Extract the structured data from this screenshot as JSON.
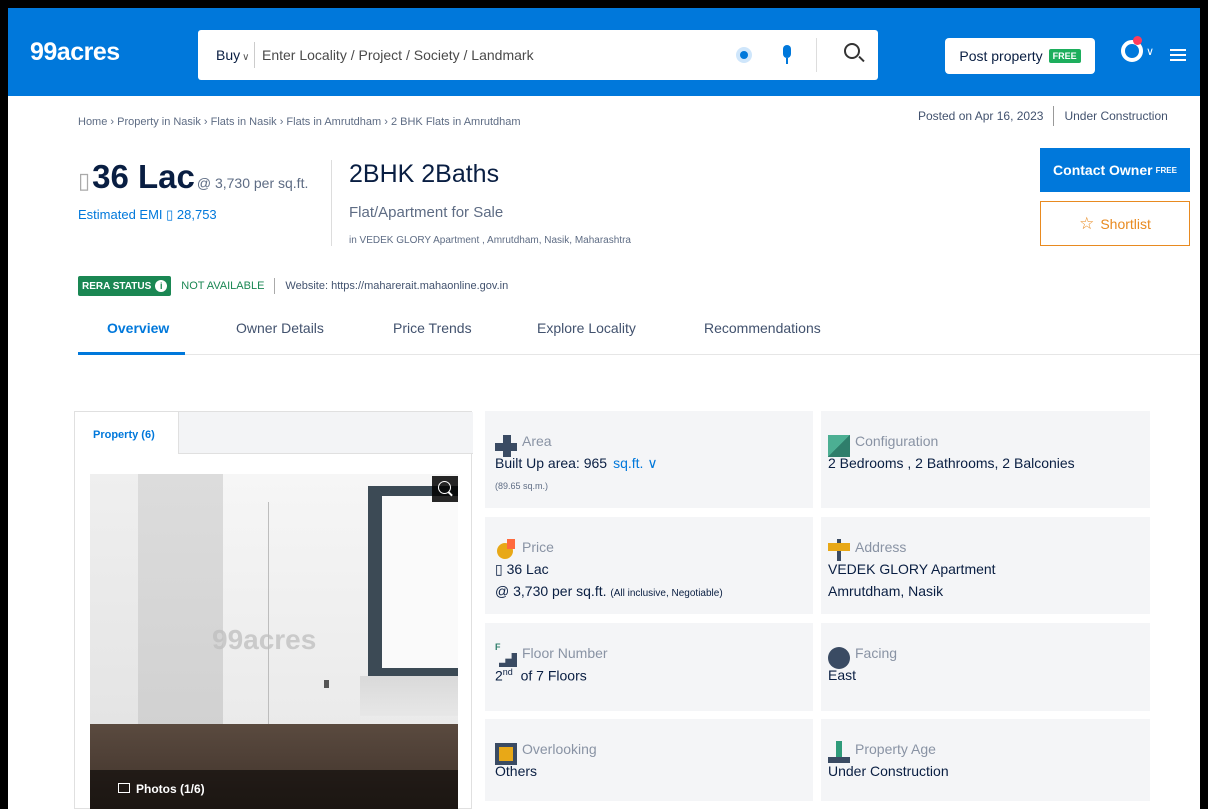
{
  "header": {
    "logo": "99acres",
    "buy_label": "Buy",
    "search_placeholder": "Enter Locality / Project / Society / Landmark",
    "post_property_label": "Post property",
    "free_tag": "FREE"
  },
  "breadcrumb": "Home › Property in Nasik › Flats in Nasik › Flats in Amrutdham › 2 BHK Flats in Amrutdham",
  "posted": {
    "date": "Posted on Apr 16, 2023",
    "status": "Under Construction"
  },
  "listing": {
    "currency_glyph": "▯",
    "price": "36 Lac",
    "price_per_sqft": "@ 3,730 per sq.ft.",
    "emi": "Estimated EMI ▯ 28,753",
    "title": "2BHK 2Baths",
    "type": "Flat/Apartment for Sale",
    "location": "in VEDEK GLORY Apartment , Amrutdham, Nasik, Maharashtra"
  },
  "actions": {
    "contact_owner": "Contact Owner",
    "contact_free": "FREE",
    "shortlist": "Shortlist"
  },
  "rera": {
    "badge": "RERA STATUS",
    "info": "i",
    "status": "NOT AVAILABLE",
    "website": "Website: https://maharerait.mahaonline.gov.in"
  },
  "tabs": [
    {
      "label": "Overview",
      "active": true
    },
    {
      "label": "Owner Details"
    },
    {
      "label": "Price Trends"
    },
    {
      "label": "Explore Locality"
    },
    {
      "label": "Recommendations"
    }
  ],
  "gallery": {
    "tab_label": "Property (6)",
    "watermark": "99acres",
    "photos_label": "Photos (1/6)"
  },
  "details": {
    "area": {
      "label": "Area",
      "value": "Built Up area: 965",
      "unit": "sq.ft.",
      "sub": "(89.65 sq.m.)"
    },
    "configuration": {
      "label": "Configuration",
      "value": "2 Bedrooms , 2 Bathrooms, 2 Balconies"
    },
    "price": {
      "label": "Price",
      "value": "▯ 36 Lac",
      "psf": "@ 3,730 per sq.ft.",
      "note": "(All inclusive, Negotiable)"
    },
    "address": {
      "label": "Address",
      "line1": "VEDEK GLORY Apartment",
      "line2": "Amrutdham, Nasik"
    },
    "floor": {
      "label": "Floor Number",
      "floor": "2",
      "suffix": "nd",
      "rest": "of 7 Floors"
    },
    "facing": {
      "label": "Facing",
      "value": "East"
    },
    "overlooking": {
      "label": "Overlooking",
      "value": "Others"
    },
    "age": {
      "label": "Property Age",
      "value": "Under Construction"
    }
  }
}
